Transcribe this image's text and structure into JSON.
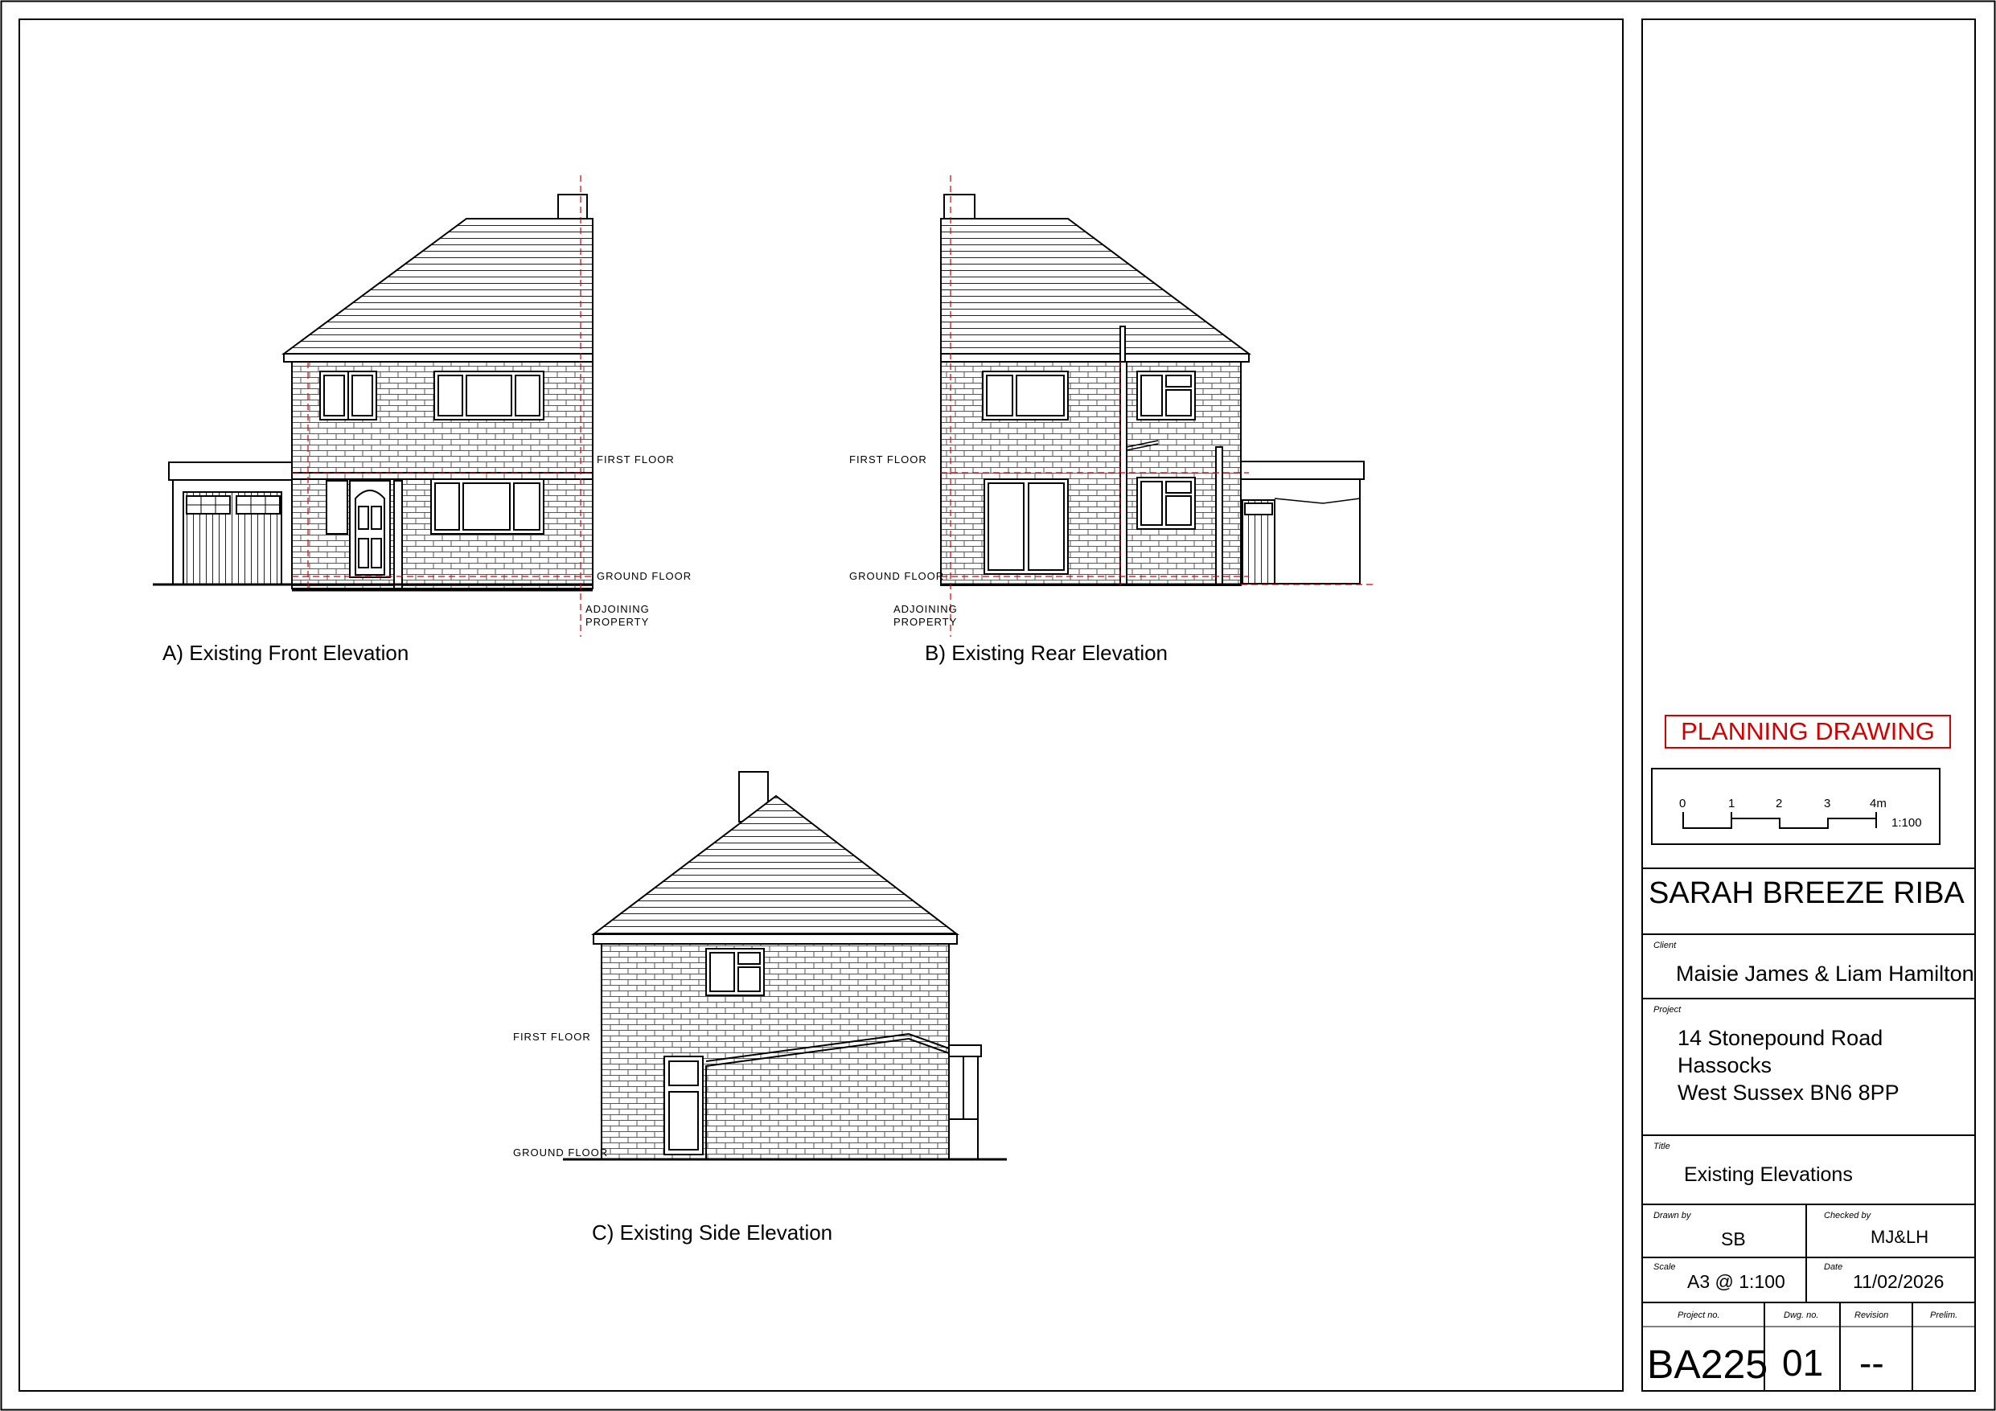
{
  "elevations": [
    {
      "id": "front",
      "caption": "A) Existing Front Elevation",
      "first_floor": "FIRST  FLOOR",
      "ground_floor": "GROUND  FLOOR",
      "adjoining": [
        "ADJOINING",
        "PROPERTY"
      ]
    },
    {
      "id": "rear",
      "caption": "B) Existing Rear Elevation",
      "first_floor": "FIRST  FLOOR",
      "ground_floor": "GROUND  FLOOR",
      "adjoining": [
        "ADJOINING",
        "PROPERTY"
      ]
    },
    {
      "id": "side",
      "caption": "C) Existing Side Elevation",
      "first_floor": "FIRST  FLOOR",
      "ground_floor": "GROUND  FLOOR"
    }
  ],
  "title_block": {
    "status": "PLANNING DRAWING",
    "scale_bar": {
      "ticks": [
        "0",
        "1",
        "2",
        "3",
        "4m"
      ],
      "ratio": "1:100"
    },
    "practice": "SARAH BREEZE RIBA",
    "client_label": "Client",
    "client": "Maisie James & Liam Hamilton",
    "project_label": "Project",
    "project_lines": [
      "14 Stonepound Road",
      "Hassocks",
      "West Sussex BN6 8PP"
    ],
    "title_label": "Title",
    "title": "Existing Elevations",
    "drawn_by_label": "Drawn by",
    "drawn_by": "SB",
    "checked_by_label": "Checked by",
    "checked_by": "MJ&LH",
    "scale_label": "Scale",
    "scale": "A3 @ 1:100",
    "date_label": "Date",
    "date": "11/02/2026",
    "project_no_label": "Project no.",
    "dwg_no_label": "Dwg. no.",
    "revision_label": "Revision",
    "prelim_label": "Prelim.",
    "project_no": "BA225",
    "dwg_no": "01",
    "revision": "--",
    "prelim": ""
  },
  "colors": {
    "line": "#000000",
    "brick": "#555555",
    "reference": "#d40000"
  }
}
